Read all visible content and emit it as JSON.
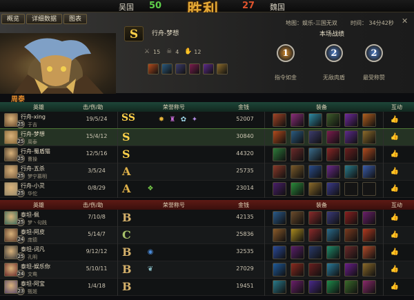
{
  "score": {
    "left_team": "吴国",
    "left_score": "50",
    "logo_text": "胜利",
    "right_score": "27",
    "right_team": "魏国"
  },
  "tabs": [
    "概览",
    "详细数据",
    "图表"
  ],
  "match_info": {
    "map": "地图：娱乐-三国无双",
    "time": "时间：  34分42秒"
  },
  "selected": {
    "rank": "S",
    "player": "行舟-梦想",
    "hero_caption": "周泰",
    "kills": "15",
    "deaths": "4",
    "assists": "12",
    "equipment_colors": [
      "#b24a1c",
      "#2a5a7f",
      "#3c3c6c",
      "#7a1c4e",
      "#5c2a8a",
      "#8b6a2a"
    ]
  },
  "battle": {
    "title": "本场战绩",
    "medals": [
      {
        "name": "指令如金",
        "icon": "medal-gold-icon",
        "mark": "1",
        "color": "#d58a2a"
      },
      {
        "name": "无敌肉盾",
        "icon": "medal-shield-icon",
        "mark": "2",
        "color": "#4a7ac5"
      },
      {
        "name": "最受称赞",
        "icon": "medal-praise-icon",
        "mark": "2",
        "color": "#4a7ac5"
      }
    ]
  },
  "headers": {
    "hero": "英雄",
    "kda": "击/伤/助",
    "title": "荣誉称号",
    "gold": "金钱",
    "equip": "装备",
    "interact": "互动"
  },
  "team_blue": [
    {
      "player": "行舟-xing",
      "level": "25",
      "hero": "于吉",
      "kda": "19/5/24",
      "grade": "S",
      "grade_color": "#ffd14a",
      "titles": [
        "title-double-s",
        "title-flame",
        "title-chess",
        "title-fish",
        "title-star"
      ],
      "gold": "52007",
      "items": [
        "#a34426",
        "#8a2d7a",
        "#2f8ba4",
        "#3d5c2a",
        "#6f2a9c",
        "#b25f1f"
      ],
      "avatar": "#6c4d30"
    },
    {
      "player": "行舟-梦想",
      "level": "25",
      "hero": "周泰",
      "kda": "15/4/12",
      "grade": "S",
      "grade_color": "#ffd14a",
      "titles": [],
      "gold": "30840",
      "items": [
        "#b24a1c",
        "#2a5a7f",
        "#3c3c6c",
        "#7a1c4e",
        "#5c2a8a",
        "#8b6a2a"
      ],
      "avatar": "#8a6a3a"
    },
    {
      "player": "行舟-蜀盾猫",
      "level": "25",
      "hero": "曹操",
      "kda": "12/5/16",
      "grade": "S",
      "grade_color": "#ffd14a",
      "titles": [],
      "gold": "44320",
      "items": [
        "#2e7a3a",
        "#6a2a2a",
        "#3a6b8a",
        "#8a2626",
        "#6b1f1f",
        "#b04a1f"
      ],
      "avatar": "#4a3a2a"
    },
    {
      "player": "行舟-五杀",
      "level": "25",
      "hero": "梦宁慕明",
      "kda": "3/5/24",
      "grade": "A",
      "grade_color": "#e0b24a",
      "titles": [],
      "gold": "25735",
      "items": [
        "#8a3a2a",
        "#7a5a2a",
        "#2a4c8a",
        "#6a2a8a",
        "#2a7a8a",
        "#3a5caa"
      ],
      "avatar": "#7a5f42"
    },
    {
      "player": "行舟-小灵",
      "level": "25",
      "hero": "华佗",
      "kda": "0/8/29",
      "grade": "A",
      "grade_color": "#e0b24a",
      "titles": [
        "title-slime"
      ],
      "gold": "23014",
      "items": [
        "#4a1f6a",
        "#2a8a3a",
        "#8a6a2a",
        "#3a3a8a",
        "#1c1c1c",
        "#1c1c1c"
      ],
      "avatar": "#9a8a6a"
    }
  ],
  "team_red": [
    {
      "player": "泰坦-佩",
      "level": "25",
      "hero": "梦丶句践",
      "kda": "7/10/8",
      "grade": "B",
      "grade_color": "#d4b06a",
      "titles": [],
      "gold": "42135",
      "items": [
        "#2a5a8a",
        "#6a4a2a",
        "#8a2a2a",
        "#3a3a7a",
        "#8a1f1f",
        "#6a1f6a"
      ],
      "avatar": "#3a6a5a"
    },
    {
      "player": "泰坦-阿皮",
      "level": "24",
      "hero": "庞德",
      "kda": "5/14/7",
      "grade": "C",
      "grade_color": "#a8c26a",
      "titles": [],
      "gold": "25836",
      "items": [
        "#8a5a2a",
        "#a8891f",
        "#8a2a2a",
        "#2a6a8a",
        "#7a3a1f",
        "#b0391f"
      ],
      "avatar": "#5a3a2a"
    },
    {
      "player": "泰坦-词凡",
      "level": "25",
      "hero": "孔明",
      "kda": "9/12/12",
      "grade": "B",
      "grade_color": "#d4b06a",
      "titles": [
        "title-orb"
      ],
      "gold": "32535",
      "items": [
        "#2a4a9a",
        "#5a1f6a",
        "#2a3a6a",
        "#1f8a6a",
        "#6a2a2a",
        "#b04a2a"
      ],
      "avatar": "#3a3a3a"
    },
    {
      "player": "泰坦-娱乐你",
      "level": "24",
      "hero": "文鸯",
      "kda": "5/10/11",
      "grade": "B",
      "grade_color": "#d4b06a",
      "titles": [
        "title-wing"
      ],
      "gold": "27029",
      "items": [
        "#1f5a9a",
        "#8a2a1f",
        "#6a1f1f",
        "#2a7a9a",
        "#6a1f8a",
        "#8a6a2a"
      ],
      "avatar": "#6a2a2a"
    },
    {
      "player": "泰坦-阿宝",
      "level": "23",
      "hero": "甄姬",
      "kda": "1/4/18",
      "grade": "B",
      "grade_color": "#d4b06a",
      "titles": [],
      "gold": "19451",
      "items": [
        "#2a7a8a",
        "#6a1f6a",
        "#4a2a8a",
        "#1f8a4a",
        "#3a6a2a",
        "#8a2a6a"
      ],
      "avatar": "#5a4a6a"
    }
  ]
}
